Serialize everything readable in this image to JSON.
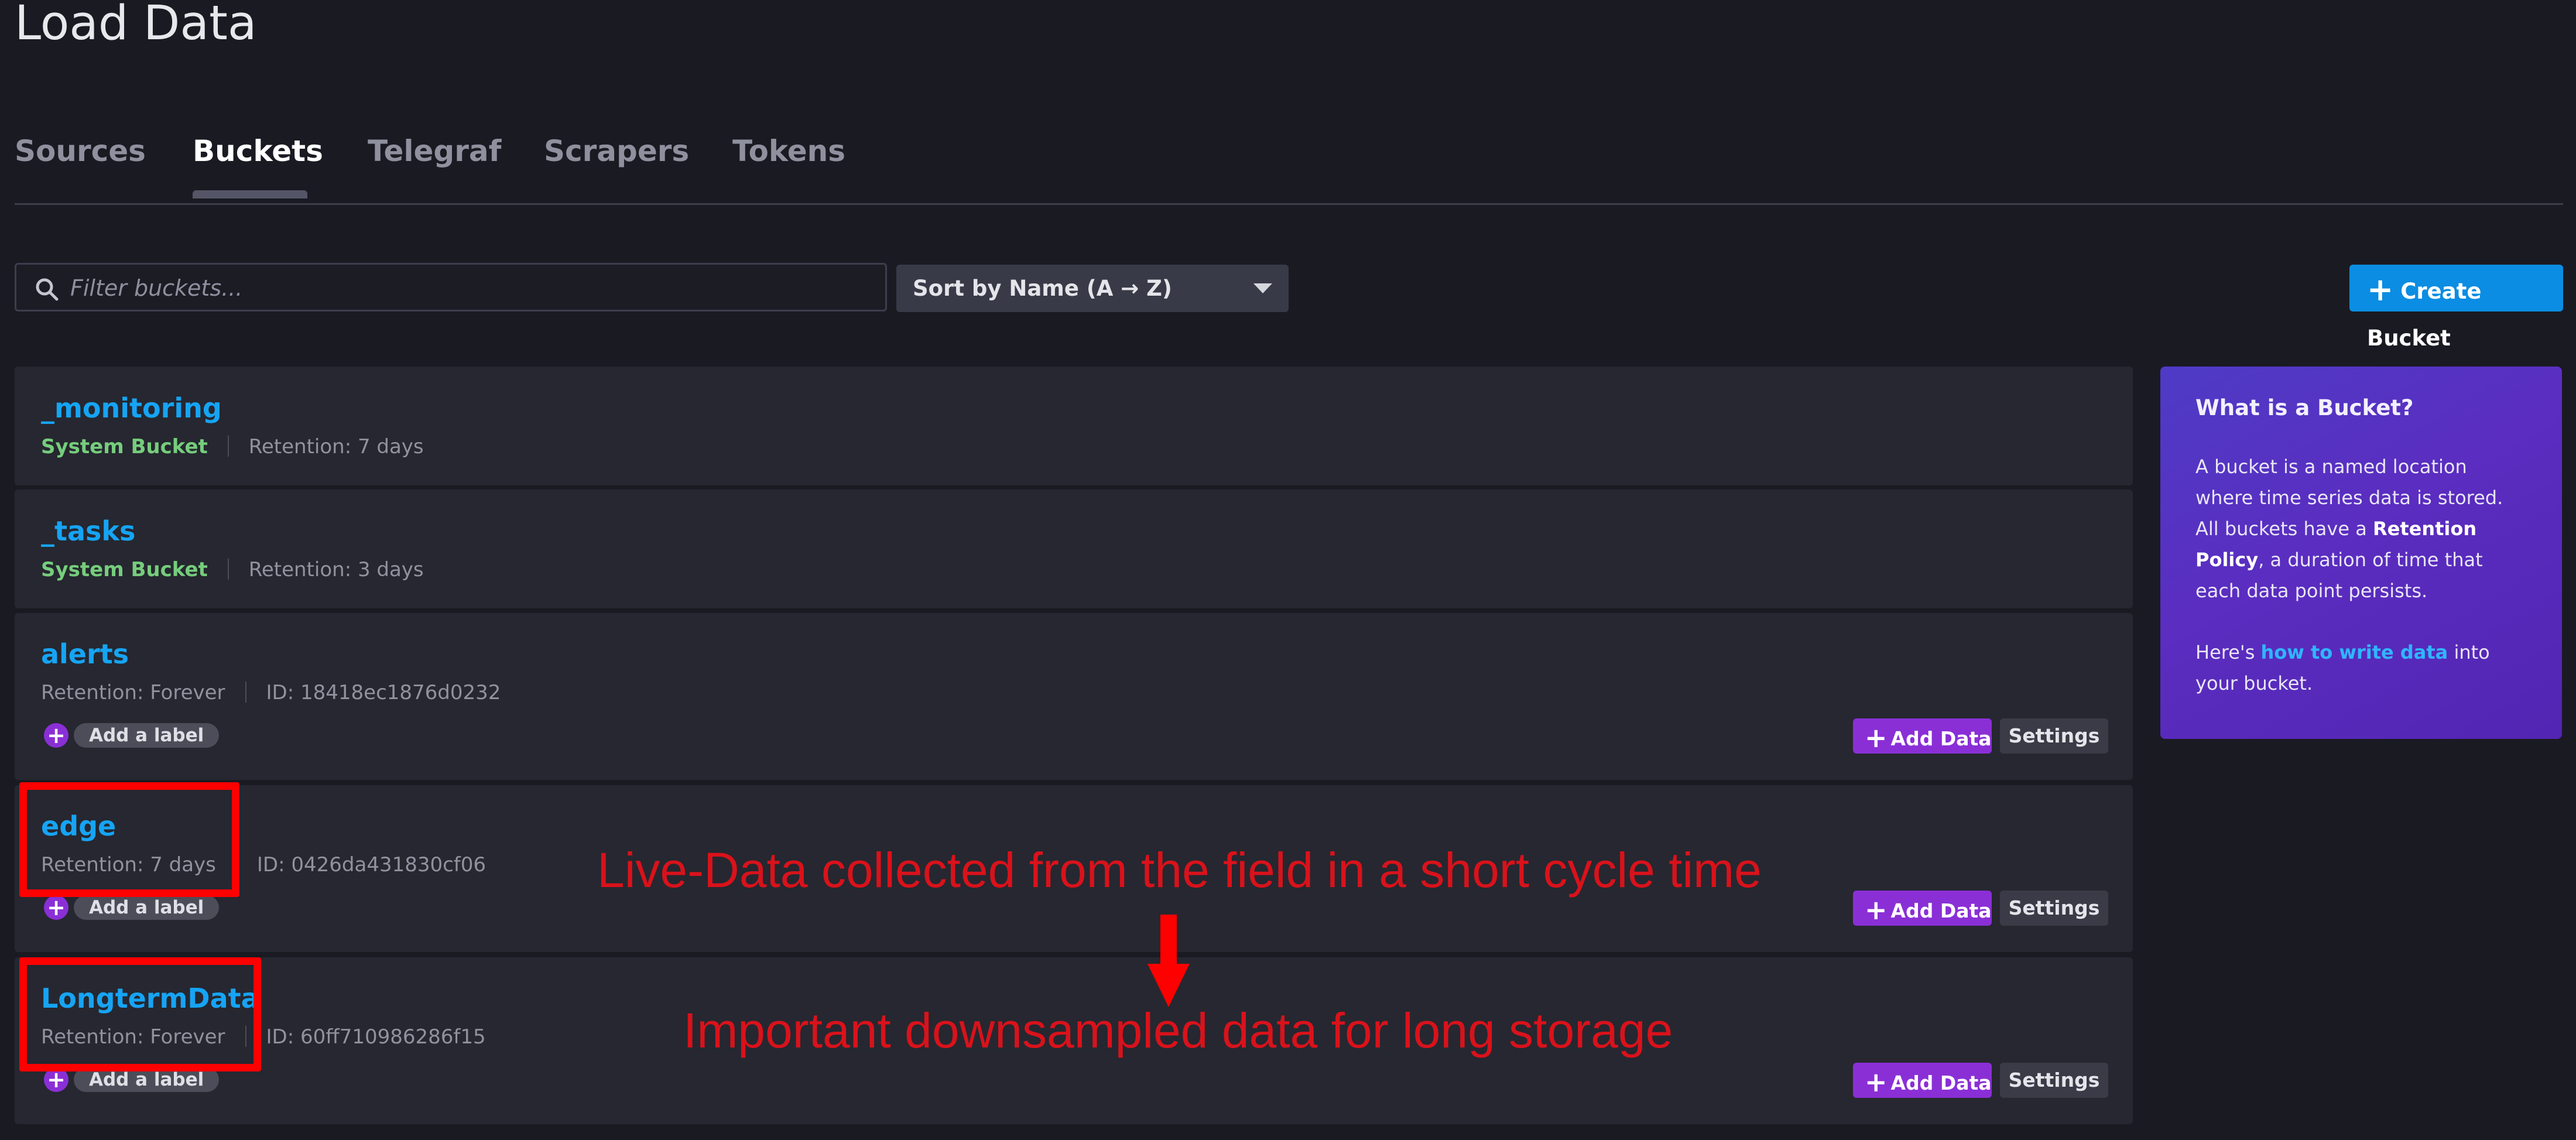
{
  "page": {
    "title": "Load Data"
  },
  "tabs": [
    {
      "label": "Sources"
    },
    {
      "label": "Buckets",
      "active": true
    },
    {
      "label": "Telegraf"
    },
    {
      "label": "Scrapers"
    },
    {
      "label": "Tokens"
    }
  ],
  "toolbar": {
    "filter_placeholder": "Filter buckets...",
    "sort_label": "Sort by Name (A → Z)",
    "create_label": "Create Bucket"
  },
  "buckets": [
    {
      "name": "_monitoring",
      "type": "System Bucket",
      "retention": "Retention: 7 days"
    },
    {
      "name": "_tasks",
      "type": "System Bucket",
      "retention": "Retention: 3 days"
    },
    {
      "name": "alerts",
      "retention": "Retention: Forever",
      "id": "ID: 18418ec1876d0232",
      "add_label": "Add a label",
      "add_data": "Add Data",
      "settings": "Settings"
    },
    {
      "name": "edge",
      "retention": "Retention: 7 days",
      "id": "ID: 0426da431830cf06",
      "add_label": "Add a label",
      "add_data": "Add Data",
      "settings": "Settings"
    },
    {
      "name": "LongtermData",
      "retention": "Retention: Forever",
      "id": "ID: 60ff710986286f15",
      "add_label": "Add a label",
      "add_data": "Add Data",
      "settings": "Settings"
    }
  ],
  "info_panel": {
    "title": "What is a Bucket?",
    "p1_pre": "A bucket is a named location where time series data is stored. All buckets have a ",
    "p1_bold": "Retention Policy",
    "p1_post": ", a duration of time that each data point persists.",
    "p2_pre": "Here's ",
    "p2_link": "how to write data",
    "p2_post": " into your bucket."
  },
  "annotations": {
    "live": "Live-Data collected from the field in a short cycle time",
    "longterm": "Important downsampled data for long storage"
  },
  "colors": {
    "background": "#1a1a22",
    "card": "#262730",
    "accent_blue": "#16a4f4",
    "primary_button": "#0a8de2",
    "add_data_purple": "#8a2fd6",
    "system_green": "#76cd7c",
    "annotation_red": "#d9121b"
  }
}
